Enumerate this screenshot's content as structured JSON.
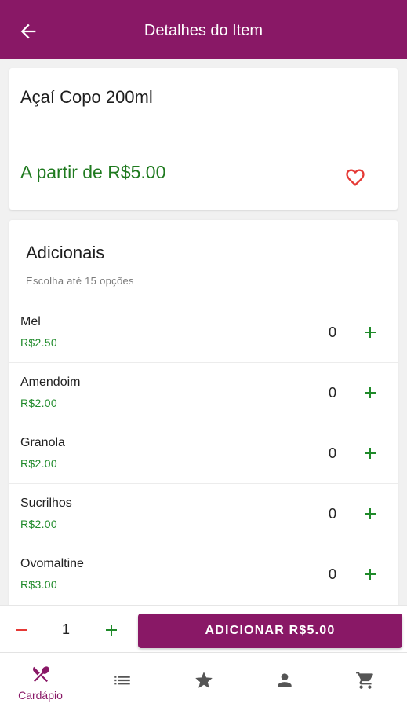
{
  "header": {
    "title": "Detalhes do Item",
    "back_icon": "arrow-left-icon",
    "color": "#891866"
  },
  "item": {
    "name": "Açaí Copo 200ml",
    "price_label": "A partir de R$5.00",
    "favorite_icon": "heart-outline-icon"
  },
  "additions": {
    "title": "Adicionais",
    "hint": "Escolha até 15 opções",
    "options": [
      {
        "name": "Mel",
        "price": "R$2.50",
        "qty": "0"
      },
      {
        "name": "Amendoim",
        "price": "R$2.00",
        "qty": "0"
      },
      {
        "name": "Granola",
        "price": "R$2.00",
        "qty": "0"
      },
      {
        "name": "Sucrilhos",
        "price": "R$2.00",
        "qty": "0"
      },
      {
        "name": "Ovomaltine",
        "price": "R$3.00",
        "qty": "0"
      }
    ]
  },
  "order": {
    "quantity": "1",
    "add_button": "ADICIONAR R$5.00"
  },
  "nav": {
    "tabs": [
      {
        "label": "Cardápio",
        "icon": "utensils-icon",
        "active": true
      },
      {
        "label": "",
        "icon": "list-icon"
      },
      {
        "label": "",
        "icon": "star-icon"
      },
      {
        "label": "",
        "icon": "person-icon"
      },
      {
        "label": "",
        "icon": "cart-icon"
      }
    ]
  },
  "colors": {
    "brand": "#891866",
    "price_green": "#1f7a1f",
    "minus_red": "#e53935",
    "heart_red": "#e53935"
  }
}
